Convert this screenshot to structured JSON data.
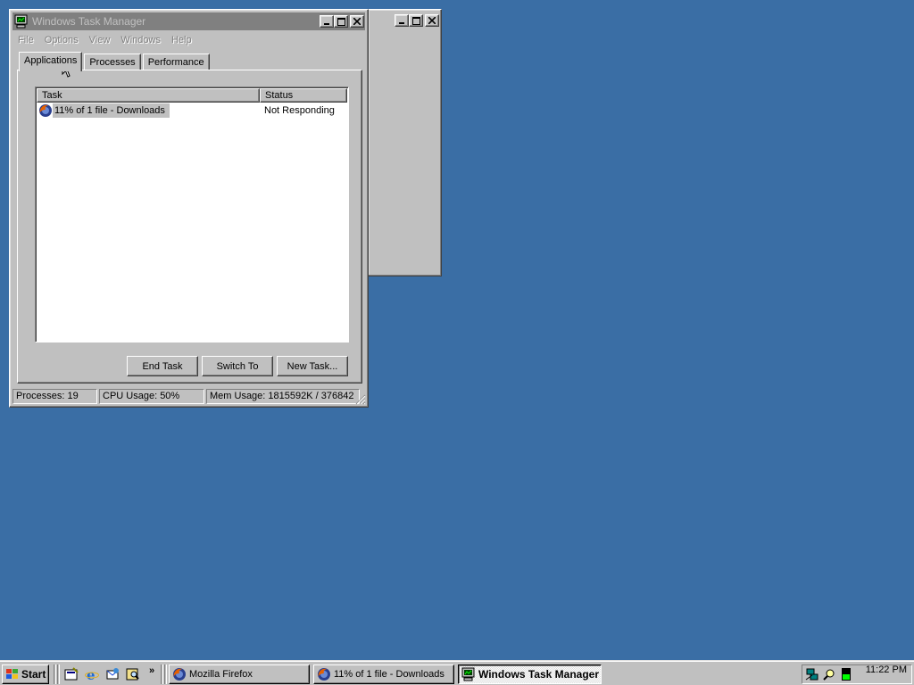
{
  "window": {
    "title": "Windows Task Manager",
    "menu": [
      "File",
      "Options",
      "View",
      "Windows",
      "Help"
    ]
  },
  "tabs": [
    {
      "label": "Applications",
      "active": true
    },
    {
      "label": "Processes",
      "active": false
    },
    {
      "label": "Performance",
      "active": false
    }
  ],
  "tasks": {
    "columns": [
      "Task",
      "Status"
    ],
    "rows": [
      {
        "task": "11% of 1 file - Downloads",
        "status": "Not Responding",
        "icon": "firefox-icon"
      }
    ]
  },
  "buttons": {
    "end_task": "End Task",
    "switch_to": "Switch To",
    "new_task": "New Task..."
  },
  "status": {
    "processes": "Processes: 19",
    "cpu": "CPU Usage: 50%",
    "mem": "Mem Usage: 1815592K / 376842"
  },
  "taskbar": {
    "start": "Start",
    "quick_launch_icons": [
      "show-desktop-icon",
      "internet-explorer-icon",
      "outlook-express-icon",
      "search-icon"
    ],
    "buttons": [
      {
        "label": "Mozilla Firefox",
        "icon": "firefox-icon",
        "active": false
      },
      {
        "label": "11% of 1 file - Downloads",
        "icon": "firefox-icon",
        "active": false
      },
      {
        "label": "Windows Task Manager",
        "icon": "task-manager-icon",
        "active": true
      }
    ],
    "tray_icons": [
      "network-icon",
      "search-icon",
      "cpu-meter-icon"
    ],
    "clock": "11:22 PM"
  },
  "colors": {
    "desktop": "#3a6ea5",
    "face": "#c0c0c0",
    "inactive_title": "#808080"
  }
}
